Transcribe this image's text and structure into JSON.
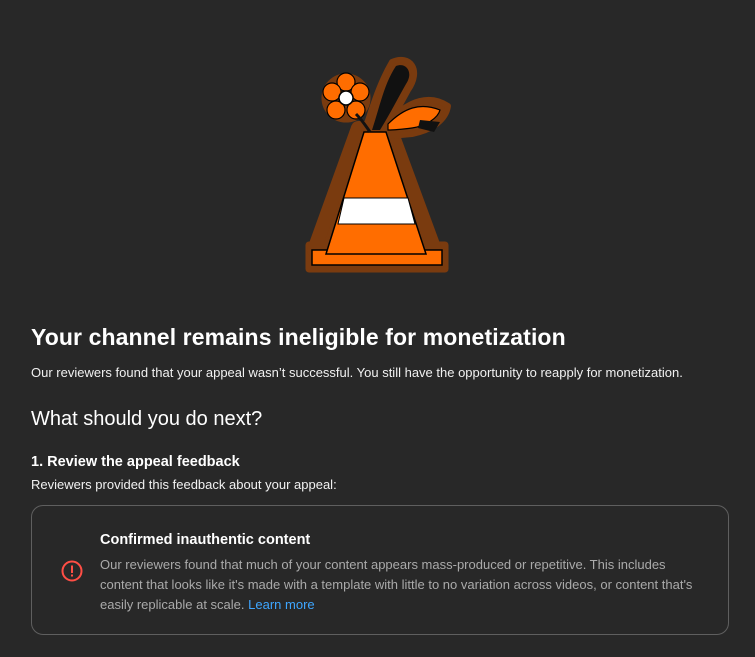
{
  "colors": {
    "background": "#282828",
    "card_border": "#5f5f5f",
    "link": "#3ea6ff",
    "error_icon": "#ff4e45",
    "cone_orange": "#ff6d00",
    "cone_outline": "#7a3b0f"
  },
  "illustration": {
    "icon": "traffic-cone-with-flower-illustration"
  },
  "header": {
    "title": "Your channel remains ineligible for monetization",
    "subtitle": "Our reviewers found that your appeal wasn’t successful. You still have the opportunity to reapply for monetization."
  },
  "next": {
    "heading": "What should you do next?",
    "step1": {
      "heading": "1. Review the appeal feedback",
      "description": "Reviewers provided this feedback about your appeal:"
    }
  },
  "feedback_card": {
    "icon": "error-circle-icon",
    "title": "Confirmed inauthentic content",
    "body": "Our reviewers found that much of your content appears mass-produced or repetitive. This includes content that looks like it's made with a template with little to no variation across videos, or content that's easily replicable at scale.",
    "link_label": "Learn more"
  }
}
